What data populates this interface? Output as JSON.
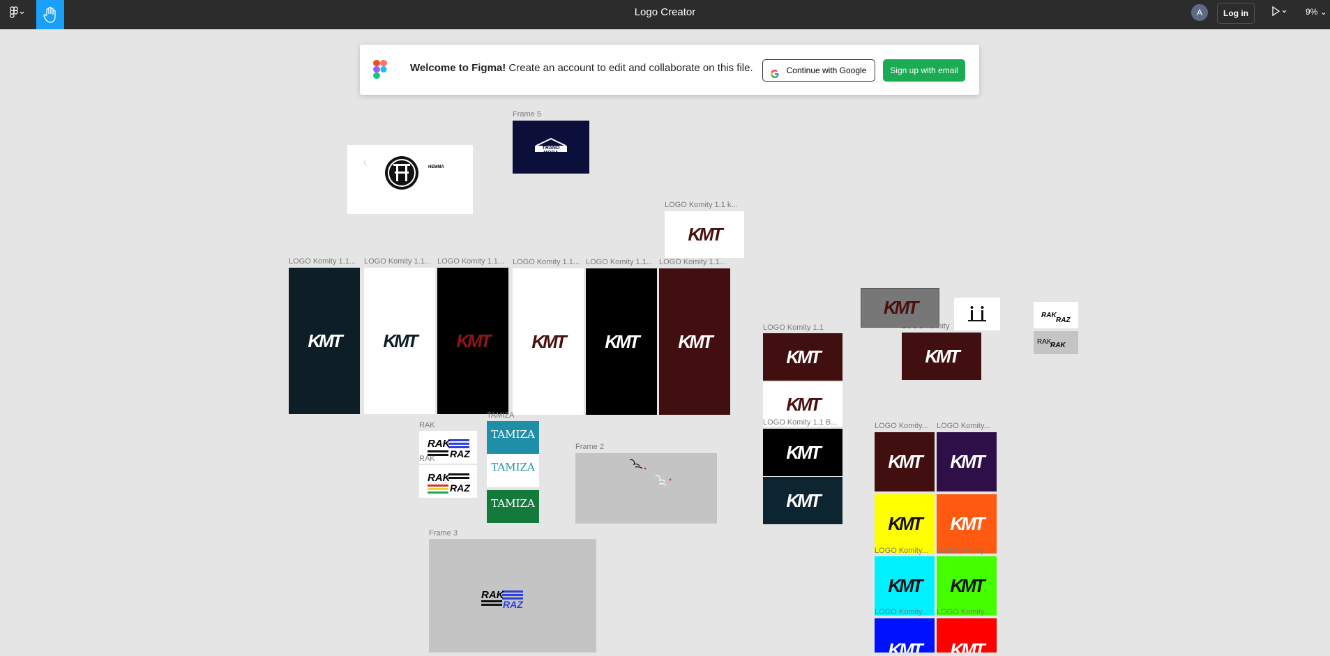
{
  "topbar": {
    "title": "Logo Creator",
    "avatar_initial": "A",
    "login_label": "Log in",
    "zoom": "9%"
  },
  "banner": {
    "welcome_bold": "Welcome to Figma!",
    "welcome_rest": " Create an account to edit and collaborate on this file.",
    "google_label": "Continue with Google",
    "email_label": "Sign up with email"
  },
  "frames": {
    "frame5_label": "Frame 5",
    "frame5_text": "TRANO MORA",
    "hemma_text": "HEMMA",
    "komity_k_label": "LOGO Komity 1.1 k...",
    "row_labels": [
      "LOGO Komity 1.1...",
      "LOGO Komity 1.1...",
      "LOGO Komity 1.1...",
      "LOGO Komity 1.1...",
      "LOGO Komity 1.1...",
      "LOGO Komity 1.1..."
    ],
    "komity11_label": "LOGO Komity 1.1",
    "komity11b_label": "LOGO Komity 1.1 B...",
    "komity_label": "LOGO Komity",
    "kmt_text": "KMT",
    "rak_label": "RAK",
    "rak_label2": "RAK",
    "rak_text": "RAK",
    "raz_text": "RAZ",
    "tamiza_label": "TAMIZA",
    "tamiza_text": "TAMIZA",
    "frame2_label": "Frame 2",
    "frame3_label": "Frame 3",
    "grid_labels": [
      "LOGO Komity...",
      "LOGO Komity..."
    ],
    "grid_label_a": "LOGO Komity...",
    "grid_label_b": "LOGO Komity...",
    "grid_label_c": "LOGO Komity...",
    "grid_label_d": "LOGO Komity..."
  },
  "colors": {
    "canvas": "#e5e5e5",
    "toolbar": "#2c2c2c",
    "accent": "#18a0fb",
    "email_button": "#1aab53"
  }
}
